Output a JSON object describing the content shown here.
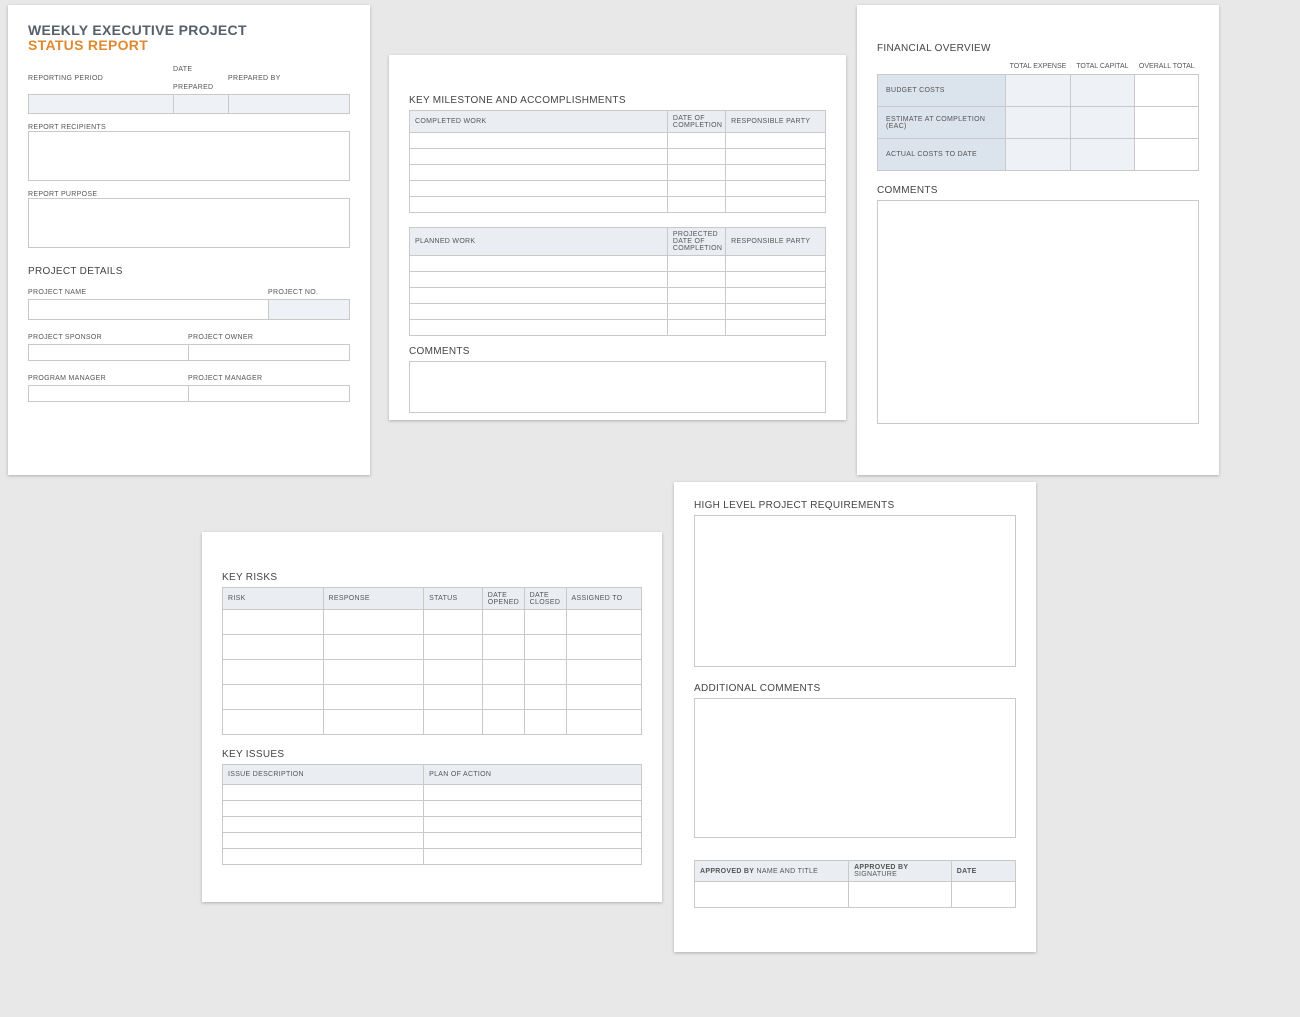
{
  "card1": {
    "title_line1": "WEEKLY EXECUTIVE PROJECT",
    "title_line2": "STATUS REPORT",
    "reporting_period_lbl": "REPORTING PERIOD",
    "date_prepared_lbl": "DATE PREPARED",
    "prepared_by_lbl": "PREPARED BY",
    "report_recipients_lbl": "REPORT RECIPIENTS",
    "report_purpose_lbl": "REPORT PURPOSE",
    "project_details_heading": "PROJECT DETAILS",
    "project_name_lbl": "PROJECT NAME",
    "project_no_lbl": "PROJECT NO.",
    "project_sponsor_lbl": "PROJECT SPONSOR",
    "project_owner_lbl": "PROJECT OWNER",
    "program_manager_lbl": "PROGRAM MANAGER",
    "project_manager_lbl": "PROJECT MANAGER"
  },
  "card2": {
    "heading": "KEY MILESTONE AND ACCOMPLISHMENTS",
    "completed_cols": [
      "COMPLETED WORK",
      "DATE OF COMPLETION",
      "RESPONSIBLE PARTY"
    ],
    "planned_cols": [
      "PLANNED WORK",
      "PROJECTED DATE OF COMPLETION",
      "RESPONSIBLE PARTY"
    ],
    "comments_lbl": "COMMENTS"
  },
  "card3": {
    "heading": "FINANCIAL OVERVIEW",
    "cols": [
      "TOTAL EXPENSE",
      "TOTAL CAPITAL",
      "OVERALL TOTAL"
    ],
    "rows": [
      "BUDGET COSTS",
      "ESTIMATE AT COMPLETION (EAC)",
      "ACTUAL COSTS TO DATE"
    ],
    "comments_lbl": "COMMENTS"
  },
  "card4": {
    "risks_heading": "KEY RISKS",
    "risks_cols": [
      "RISK",
      "RESPONSE",
      "STATUS",
      "DATE OPENED",
      "DATE CLOSED",
      "ASSIGNED TO"
    ],
    "issues_heading": "KEY ISSUES",
    "issues_cols": [
      "ISSUE DESCRIPTION",
      "PLAN OF ACTION"
    ]
  },
  "card5": {
    "req_heading": "HIGH LEVEL PROJECT REQUIREMENTS",
    "comments_heading": "ADDITIONAL COMMENTS",
    "approved_by_lbl": "APPROVED BY",
    "name_title_lbl": " NAME AND TITLE",
    "signature_lbl": " SIGNATURE",
    "date_lbl": "DATE"
  }
}
